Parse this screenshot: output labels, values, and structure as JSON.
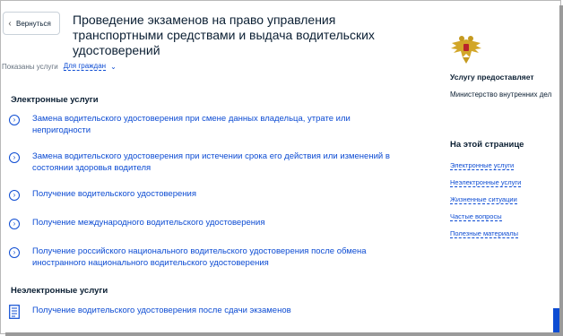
{
  "header": {
    "back_label": "Вернуться",
    "title": "Проведение экзаменов на право управления транспортными средствами и выдача водительских удостоверений"
  },
  "filter": {
    "label": "Показаны услуги",
    "value": "Для граждан"
  },
  "electronic": {
    "title": "Электронные услуги",
    "items": [
      {
        "label": "Замена водительского удостоверения при смене данных владельца, утрате или непригодности"
      },
      {
        "label": "Замена водительского удостоверения при истечении срока его действия или изменений в состоянии здоровья водителя"
      },
      {
        "label": "Получение водительского удостоверения"
      },
      {
        "label": "Получение международного водительского удостоверения"
      },
      {
        "label": "Получение российского национального водительского удостоверения после обмена иностранного национального водительского удостоверения"
      }
    ]
  },
  "non_electronic": {
    "title": "Неэлектронные услуги",
    "items": [
      {
        "label": "Получение водительского удостоверения после сдачи экзаменов"
      }
    ]
  },
  "sidebar": {
    "provider_title": "Услугу предоставляет",
    "provider_name": "Министерство внутренних дел Российской Федерации",
    "on_page_title": "На этой странице",
    "links": [
      "Электронные услуги",
      "Неэлектронные услуги",
      "Жизненные ситуации",
      "Частые вопросы",
      "Полезные материалы"
    ]
  },
  "colors": {
    "link": "#0d4cd3",
    "text": "#0b1f33",
    "muted": "#66727f",
    "emblem_gold": "#d2a628"
  },
  "icons": {
    "back": "chevron-left-icon",
    "dropdown": "chevron-down-icon",
    "service": "circle-chevron-right-icon",
    "document": "document-icon",
    "emblem": "mvd-emblem-icon"
  }
}
